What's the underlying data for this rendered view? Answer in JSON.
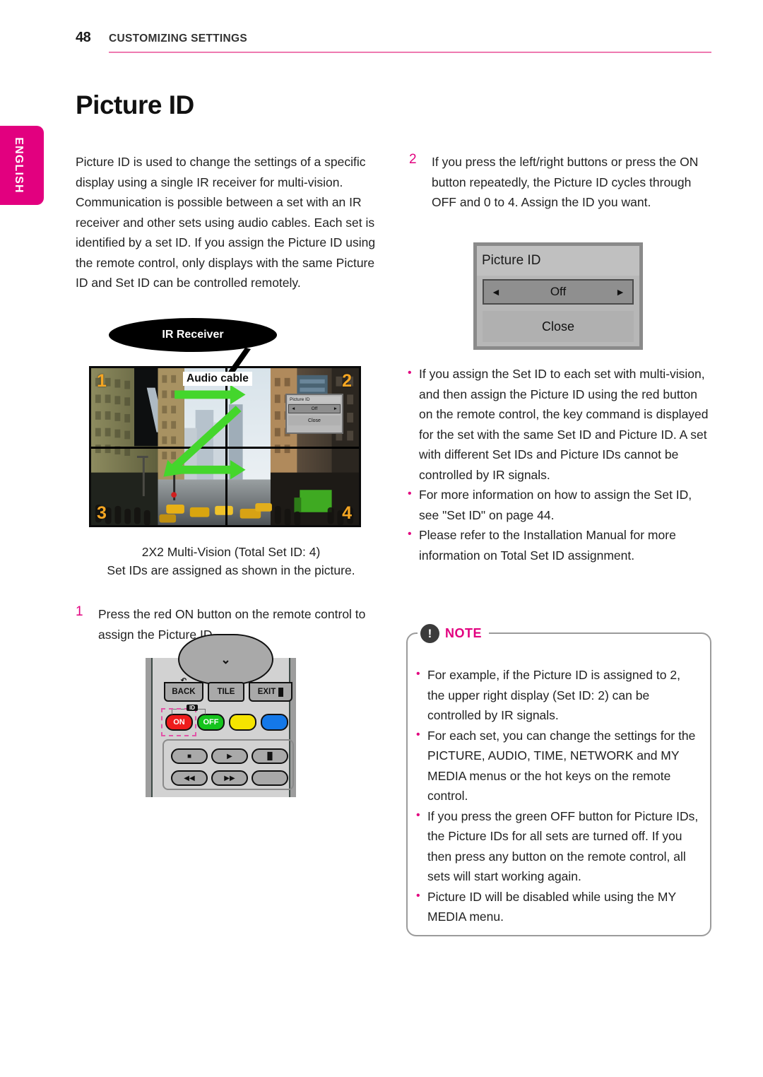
{
  "header": {
    "page_number": "48",
    "section_title": "CUSTOMIZING SETTINGS",
    "rule_color": "#ee7ab0"
  },
  "language_tab": {
    "label": "ENGLISH",
    "color": "#e2007f"
  },
  "page_title": "Picture ID",
  "left_column": {
    "intro_paragraph": "Picture ID is used to change the settings of a specific display using a single IR receiver for multi-vision. Communication is possible between a set with an IR receiver and other sets using audio cables. Each set is identified by a set ID. If you assign the Picture ID using the remote control, only displays with the same Picture ID and Set ID can be controlled remotely.",
    "diagram": {
      "callout_ir_receiver": "IR Receiver",
      "callout_audio_cable": "Audio cable",
      "set_numbers": [
        "1",
        "2",
        "3",
        "4"
      ],
      "number_color": "#f5a623",
      "arrow_color": "#44d62c",
      "mini_osd": {
        "title": "Picture ID",
        "value": "Off",
        "left_arrow": "◄",
        "right_arrow": "►",
        "close_label": "Close"
      }
    },
    "caption_line1": "2X2 Multi-Vision (Total Set ID: 4)",
    "caption_line2": "Set IDs are assigned as shown in the picture.",
    "step1": {
      "number": "1",
      "text": "Press the red ON button on the remote control to assign the Picture ID."
    },
    "remote": {
      "chevron": "⌄",
      "back_label": "BACK",
      "back_icon": "↶",
      "tile_label": "TILE",
      "exit_label": "EXIT",
      "id_tag": "ID",
      "on_label": "ON",
      "off_label": "OFF",
      "yellow_label": "",
      "blue_label": "",
      "on_color": "#ee1b1b",
      "off_color": "#15c41c",
      "yellow_color": "#f5e400",
      "blue_color": "#1478e8",
      "highlight_color": "#e255a8",
      "media_buttons": [
        "■",
        "▶",
        "▐▌",
        "◀◀",
        "▶▶",
        ""
      ]
    }
  },
  "right_column": {
    "step2": {
      "number": "2",
      "text": "If you press the left/right buttons or press the ON button repeatedly, the Picture ID cycles through OFF and 0 to 4. Assign the ID you want."
    },
    "osd": {
      "title": "Picture ID",
      "value": "Off",
      "left_arrow": "◄",
      "right_arrow": "►",
      "close_label": "Close"
    },
    "bullets": [
      "If you assign the Set ID to each set with multi-vision, and then assign the Picture ID using the red button on the remote control, the key command is displayed for the set with the same Set ID and Picture ID. A set with different Set IDs and Picture IDs cannot be controlled by IR signals.",
      "For more information on how to assign the Set ID, see \"Set ID\" on page 44.",
      "Please refer to the Installation Manual for more information on Total Set ID assignment."
    ],
    "note": {
      "icon": "!",
      "label": "NOTE",
      "accent_color": "#e2007f",
      "bullets": [
        "For example, if the Picture ID is assigned to 2, the upper right display (Set ID: 2) can be controlled by IR signals.",
        "For each set, you can change the settings for the PICTURE, AUDIO, TIME, NETWORK and MY MEDIA menus or the hot keys on the remote control.",
        "If you press the green OFF button for Picture IDs, the Picture IDs for all sets are turned off. If you then press any button on the remote control, all sets will start working again.",
        "Picture ID will be disabled while using the MY MEDIA menu."
      ]
    }
  }
}
